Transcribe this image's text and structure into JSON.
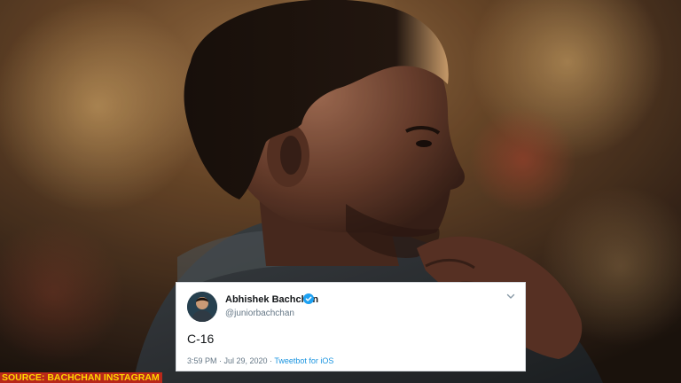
{
  "tweet": {
    "name": "Abhishek Bachchan",
    "handle": "@juniorbachchan",
    "text": "C-16",
    "time": "3:59 PM · Jul 29, 2020 ·",
    "source": "Tweetbot for iOS",
    "verified_icon": "verified-badge-icon",
    "menu_icon": "chevron-down-icon",
    "accent_color": "#1b95e0"
  },
  "caption": {
    "text": "SOURCE: BACHCHAN INSTAGRAM",
    "background_color": "#b8281a",
    "text_color": "#ffd700"
  }
}
